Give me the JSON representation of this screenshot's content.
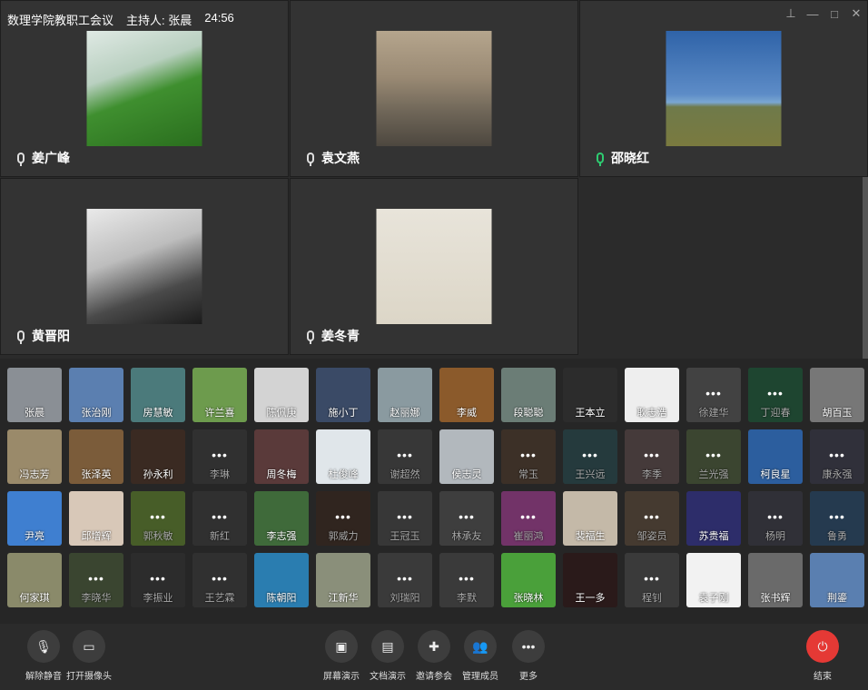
{
  "meeting": {
    "title": "数理学院教职工会议",
    "host": "主持人: 张晨",
    "time": "24:56"
  },
  "video_tiles": [
    {
      "name": "姜广峰",
      "mic": "normal",
      "image": "plant"
    },
    {
      "name": "袁文燕",
      "mic": "normal",
      "image": "wall"
    },
    {
      "name": "邵晓红",
      "mic": "green",
      "image": "trees"
    },
    {
      "name": "黄晋阳",
      "mic": "normal",
      "image": "bw"
    },
    {
      "name": "姜冬青",
      "mic": "normal",
      "image": "drawing"
    }
  ],
  "participants": {
    "row1": [
      {
        "name": "张晨",
        "color": "#8a8f95",
        "dots": false
      },
      {
        "name": "张治刚",
        "color": "#5b7fb0",
        "dots": false
      },
      {
        "name": "房慧敏",
        "color": "#4b7a7b",
        "dots": false
      },
      {
        "name": "许兰喜",
        "color": "#6d9b4d",
        "dots": false
      },
      {
        "name": "陈佩庚",
        "color": "#d3d3d3",
        "dots": false
      },
      {
        "name": "施小丁",
        "color": "#3a4a66",
        "dots": false
      },
      {
        "name": "赵丽娜",
        "color": "#8a9aa0",
        "dots": false
      },
      {
        "name": "李威",
        "color": "#8b5a2b",
        "dots": false
      },
      {
        "name": "段聪聪",
        "color": "#6b7d76",
        "dots": false
      },
      {
        "name": "王本立",
        "color": "#2c2c2c",
        "dots": false
      },
      {
        "name": "耿志浩",
        "color": "#eeeeee",
        "dots": false
      },
      {
        "name": "徐建华",
        "color": "#666666",
        "dots": true
      },
      {
        "name": "丁迎春",
        "color": "#2f6b4a",
        "dots": true
      },
      {
        "name": "胡百玉",
        "color": "#777777",
        "dots": false
      }
    ],
    "row2": [
      {
        "name": "冯志芳",
        "color": "#9a8a6a",
        "dots": false
      },
      {
        "name": "张泽英",
        "color": "#7b5c3a",
        "dots": false
      },
      {
        "name": "孙永利",
        "color": "#3a2a22",
        "dots": false
      },
      {
        "name": "李琳",
        "color": "#4a4a4a",
        "dots": true
      },
      {
        "name": "周冬梅",
        "color": "#5a3a3a",
        "dots": false
      },
      {
        "name": "杜俊峰",
        "color": "#e0e6ea",
        "dots": false
      },
      {
        "name": "谢超然",
        "color": "#555555",
        "dots": true
      },
      {
        "name": "侯志灵",
        "color": "#b2b8bd",
        "dots": false
      },
      {
        "name": "常玉",
        "color": "#5c4a3c",
        "dots": true
      },
      {
        "name": "王兴远",
        "color": "#3a5a5f",
        "dots": true
      },
      {
        "name": "李季",
        "color": "#6a5a5a",
        "dots": true
      },
      {
        "name": "兰光强",
        "color": "#5b6a4a",
        "dots": true
      },
      {
        "name": "柯良星",
        "color": "#2c5e9e",
        "dots": false
      },
      {
        "name": "康永强",
        "color": "#4a4a5a",
        "dots": true
      }
    ],
    "row3": [
      {
        "name": "尹亮",
        "color": "#3f7fd0",
        "dots": false
      },
      {
        "name": "邱增辉",
        "color": "#d8c8b8",
        "dots": false
      },
      {
        "name": "郭秋敏",
        "color": "#6e8f3e",
        "dots": true
      },
      {
        "name": "新红",
        "color": "#4a4a4a",
        "dots": true
      },
      {
        "name": "李志强",
        "color": "#3f6a3a",
        "dots": false
      },
      {
        "name": "郭威力",
        "color": "#4a3a30",
        "dots": true
      },
      {
        "name": "王冠玉",
        "color": "#555555",
        "dots": true
      },
      {
        "name": "林承友",
        "color": "#606060",
        "dots": true
      },
      {
        "name": "崔丽鸿",
        "color": "#b04fa0",
        "dots": true
      },
      {
        "name": "裴福生",
        "color": "#c4b9a8",
        "dots": false
      },
      {
        "name": "邹姿员",
        "color": "#6a5a4a",
        "dots": true
      },
      {
        "name": "苏贵福",
        "color": "#2d2d6a",
        "dots": false
      },
      {
        "name": "杨明",
        "color": "#4a4a55",
        "dots": true
      },
      {
        "name": "鲁勇",
        "color": "#3a5a7a",
        "dots": true
      }
    ],
    "row4": [
      {
        "name": "何家琪",
        "color": "#8a8a6a",
        "dots": false
      },
      {
        "name": "李晓华",
        "color": "#5a6a4a",
        "dots": true
      },
      {
        "name": "李振业",
        "color": "#444444",
        "dots": true
      },
      {
        "name": "王艺霖",
        "color": "#4a4a4a",
        "dots": true
      },
      {
        "name": "陈朝阳",
        "color": "#2a7db0",
        "dots": false
      },
      {
        "name": "江新华",
        "color": "#8a8f7a",
        "dots": false
      },
      {
        "name": "刘瑞阳",
        "color": "#5a5a5a",
        "dots": true
      },
      {
        "name": "李默",
        "color": "#5a5a5a",
        "dots": true
      },
      {
        "name": "张晓林",
        "color": "#4aa03a",
        "dots": false
      },
      {
        "name": "王一多",
        "color": "#2a1a1a",
        "dots": false
      },
      {
        "name": "程钊",
        "color": "#5a5a5a",
        "dots": true
      },
      {
        "name": "袁子刚",
        "color": "#f2f2f2",
        "dots": false
      },
      {
        "name": "张书辉",
        "color": "#6a6a6a",
        "dots": false
      },
      {
        "name": "荆鎏",
        "color": "#5a7fb0",
        "dots": false
      }
    ]
  },
  "toolbar": {
    "left": [
      {
        "label": "解除静音",
        "icon": "mic-off-icon"
      },
      {
        "label": "打开摄像头",
        "icon": "camera-off-icon"
      }
    ],
    "center": [
      {
        "label": "屏幕演示",
        "icon": "screen-share-icon"
      },
      {
        "label": "文档演示",
        "icon": "document-icon"
      },
      {
        "label": "邀请参会",
        "icon": "add-user-icon"
      },
      {
        "label": "管理成员",
        "icon": "members-icon"
      },
      {
        "label": "更多",
        "icon": "more-icon"
      }
    ],
    "end": {
      "label": "结束",
      "icon": "power-icon"
    }
  }
}
